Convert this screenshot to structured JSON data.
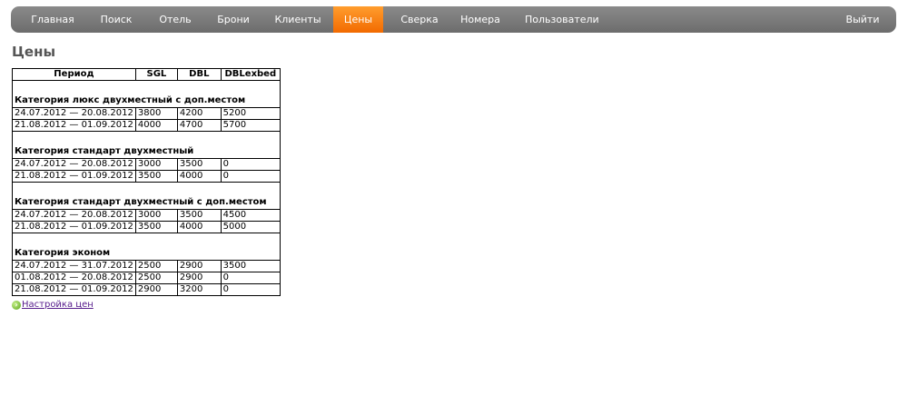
{
  "nav": {
    "items": [
      {
        "id": "main",
        "label": "Главная"
      },
      {
        "id": "search",
        "label": "Поиск"
      },
      {
        "id": "hotel",
        "label": "Отель"
      },
      {
        "id": "bookings",
        "label": "Брони"
      },
      {
        "id": "clients",
        "label": "Клиенты"
      },
      {
        "id": "prices",
        "label": "Цены"
      },
      {
        "id": "reconciliation",
        "label": "Сверка"
      },
      {
        "id": "rooms",
        "label": "Номера"
      },
      {
        "id": "users",
        "label": "Пользователи"
      }
    ],
    "active": "prices",
    "logout_label": "Выйти",
    "colors": {
      "bar": "#7a7a7a",
      "active": "#f7820d",
      "text": "#ffffff"
    }
  },
  "page": {
    "title": "Цены"
  },
  "table": {
    "headers": [
      "Период",
      "SGL",
      "DBL",
      "DBLexbed"
    ],
    "categories": [
      {
        "name": "Категория люкс двухместный с доп.местом",
        "rows": [
          [
            "24.07.2012 — 20.08.2012",
            "3800",
            "4200",
            "5200"
          ],
          [
            "21.08.2012 — 01.09.2012",
            "4000",
            "4700",
            "5700"
          ]
        ]
      },
      {
        "name": "Категория стандарт двухместный",
        "rows": [
          [
            "24.07.2012 — 20.08.2012",
            "3000",
            "3500",
            "0"
          ],
          [
            "21.08.2012 — 01.09.2012",
            "3500",
            "4000",
            "0"
          ]
        ]
      },
      {
        "name": "Категория стандарт двухместный с доп.местом",
        "rows": [
          [
            "24.07.2012 — 20.08.2012",
            "3000",
            "3500",
            "4500"
          ],
          [
            "21.08.2012 — 01.09.2012",
            "3500",
            "4000",
            "5000"
          ]
        ]
      },
      {
        "name": "Категория эконом",
        "rows": [
          [
            "24.07.2012 — 31.07.2012",
            "2500",
            "2900",
            "3500"
          ],
          [
            "01.08.2012 — 20.08.2012",
            "2500",
            "2900",
            "0"
          ],
          [
            "21.08.2012 — 01.09.2012",
            "2900",
            "3200",
            "0"
          ]
        ]
      }
    ]
  },
  "settings_link": {
    "label": "Настройка цен",
    "icon": "settings-icon"
  }
}
